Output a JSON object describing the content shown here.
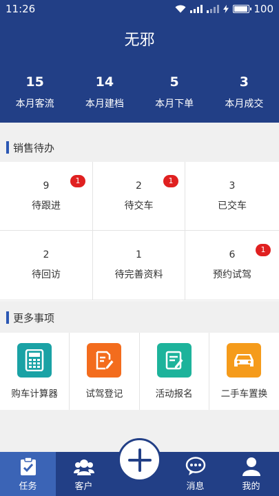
{
  "status": {
    "time": "11:26",
    "battery": "100",
    "battery_level": 1.0
  },
  "header": {
    "title": "无邪"
  },
  "stats": [
    {
      "value": "15",
      "label": "本月客流"
    },
    {
      "value": "14",
      "label": "本月建档"
    },
    {
      "value": "5",
      "label": "本月下单"
    },
    {
      "value": "3",
      "label": "本月成交"
    }
  ],
  "sales": {
    "title": "销售待办",
    "items": [
      {
        "count": "9",
        "label": "待跟进",
        "badge": "1"
      },
      {
        "count": "2",
        "label": "待交车",
        "badge": "1"
      },
      {
        "count": "3",
        "label": "已交车",
        "badge": ""
      },
      {
        "count": "2",
        "label": "待回访",
        "badge": ""
      },
      {
        "count": "1",
        "label": "待完善资料",
        "badge": ""
      },
      {
        "count": "6",
        "label": "预约试驾",
        "badge": "1"
      }
    ]
  },
  "more": {
    "title": "更多事项",
    "items": [
      {
        "label": "购车计算器",
        "icon": "calculator-icon",
        "color": "#1aa2a5"
      },
      {
        "label": "试驾登记",
        "icon": "edit-document-icon",
        "color": "#f36c1d"
      },
      {
        "label": "活动报名",
        "icon": "signup-form-icon",
        "color": "#1db39b"
      },
      {
        "label": "二手车置换",
        "icon": "car-icon",
        "color": "#f59b1b"
      }
    ]
  },
  "tabs": [
    {
      "label": "任务",
      "icon": "task-clipboard-icon",
      "active": true
    },
    {
      "label": "客户",
      "icon": "customers-icon",
      "active": false
    },
    {
      "label": "消息",
      "icon": "message-bubble-icon",
      "active": false
    },
    {
      "label": "我的",
      "icon": "profile-icon",
      "active": false
    }
  ],
  "colors": {
    "primary": "#223f86",
    "badge": "#e02020",
    "tab_active": "#3b64b6"
  }
}
